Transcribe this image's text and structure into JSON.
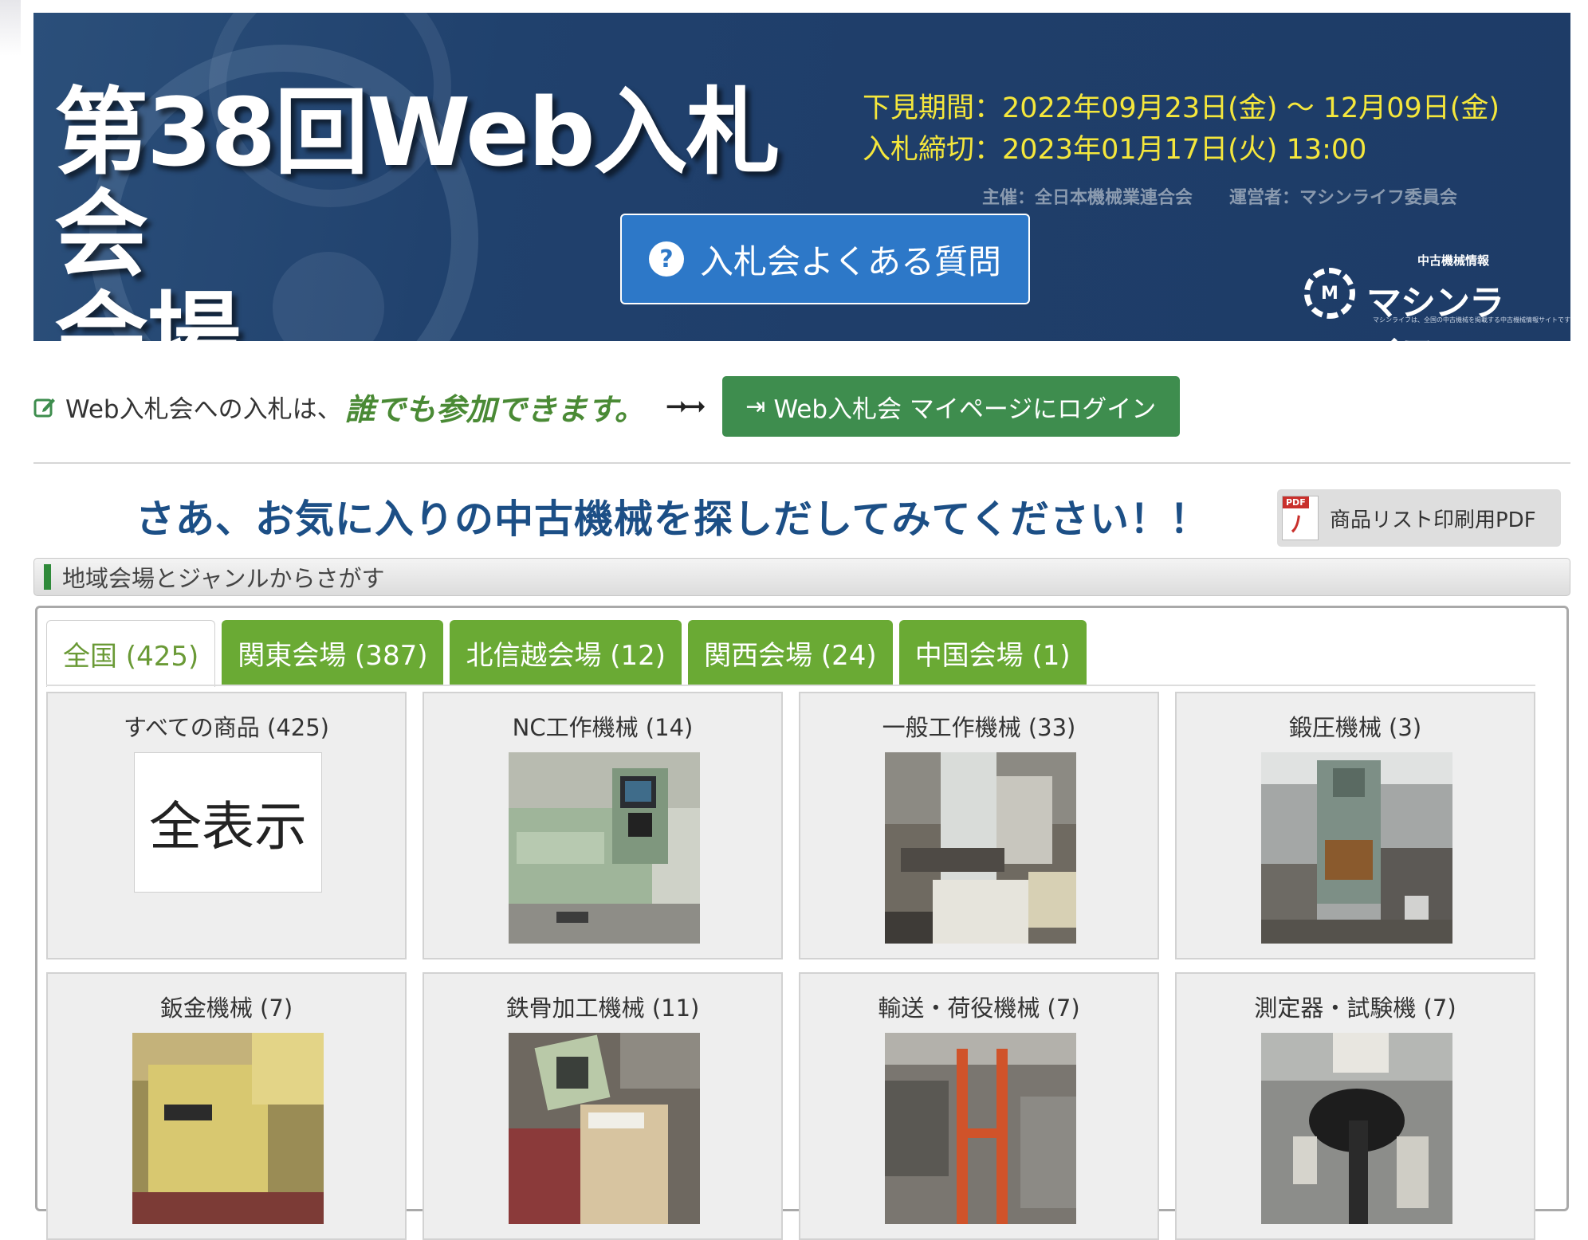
{
  "banner": {
    "title_line1": "第38回Web入札会",
    "title_line2": "会場",
    "preview_period": "下見期間：2022年09月23日(金) 〜 12月09日(金)",
    "bid_deadline": "入札締切：2023年01月17日(火) 13:00",
    "organizer": "主催：全日本機械業連合会",
    "operator": "運営者：マシンライフ委員会",
    "faq_button": "入札会よくある質問",
    "logo_small": "中古機械情報",
    "logo_name": "マシンライフ",
    "logo_tagline": "マシンライフは、全国の中古機械を掲載する中古機械情報サイトです",
    "accent_color": "#f5e73c"
  },
  "login": {
    "text": "Web入札会への入札は、",
    "emphasis": "誰でも参加できます。",
    "arrows": "➞➞",
    "button": "Web入札会 マイページにログイン"
  },
  "headline": "さあ、お気に入りの中古機械を探しだしてみてください！！",
  "pdf_button": "商品リスト印刷用PDF",
  "pdf_tag": "PDF",
  "section_label": "地域会場とジャンルからさがす",
  "tabs": [
    {
      "label": "全国 (425)",
      "active": true
    },
    {
      "label": "関東会場 (387)",
      "active": false
    },
    {
      "label": "北信越会場 (12)",
      "active": false
    },
    {
      "label": "関西会場 (24)",
      "active": false
    },
    {
      "label": "中国会場 (1)",
      "active": false
    }
  ],
  "categories": [
    {
      "title": "すべての商品 (425)",
      "thumb_text": "全表示"
    },
    {
      "title": "NC工作機械 (14)"
    },
    {
      "title": "一般工作機械 (33)"
    },
    {
      "title": "鍛圧機械 (3)"
    },
    {
      "title": "鈑金機械 (7)"
    },
    {
      "title": "鉄骨加工機械 (11)"
    },
    {
      "title": "輸送・荷役機械 (7)"
    },
    {
      "title": "測定器・試験機 (7)"
    }
  ]
}
